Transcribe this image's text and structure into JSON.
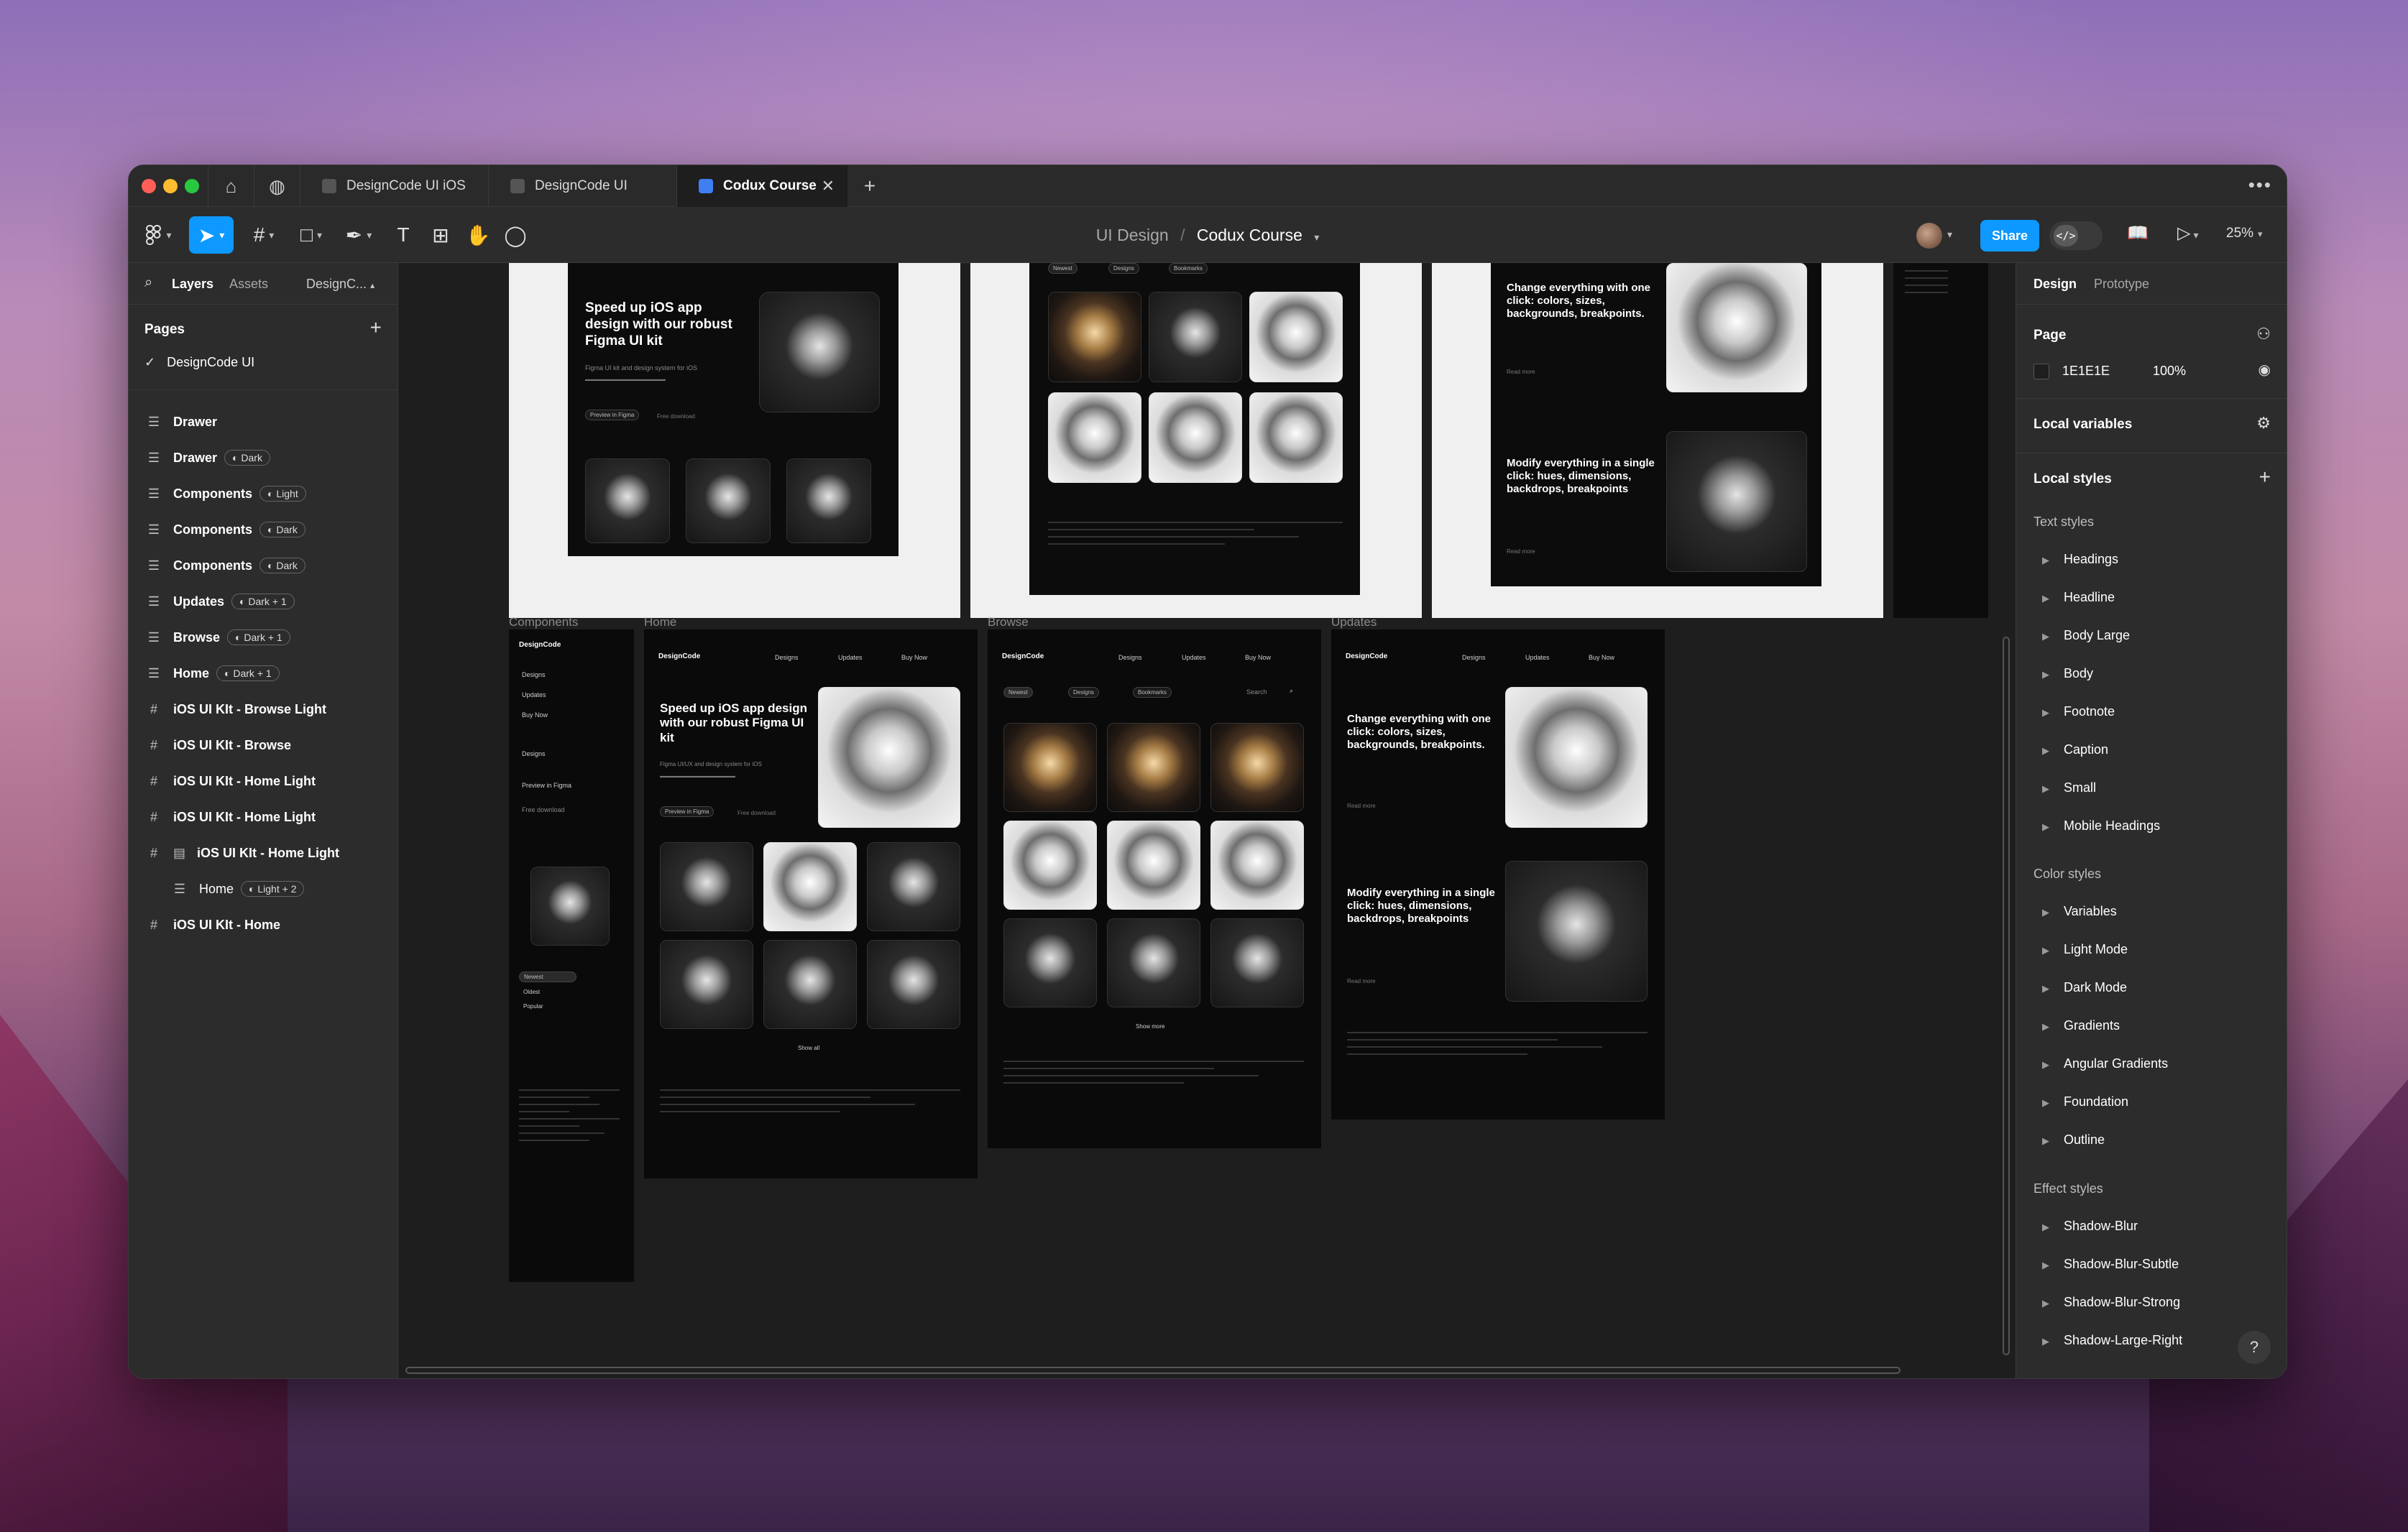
{
  "tabbar": {
    "tabs": [
      {
        "label": "DesignCode UI iOS"
      },
      {
        "label": "DesignCode UI"
      },
      {
        "label": "Codux Course"
      }
    ]
  },
  "toolbar": {
    "breadcrumb_parent": "UI Design",
    "breadcrumb_current": "Codux Course",
    "share_label": "Share",
    "zoom_label": "25%"
  },
  "left_panel": {
    "tab_layers": "Layers",
    "tab_assets": "Assets",
    "tab_file": "DesignC...",
    "pages_header": "Pages",
    "current_page": "DesignCode UI",
    "layers": [
      {
        "label": "Drawer",
        "badge": ""
      },
      {
        "label": "Drawer",
        "badge": "Dark"
      },
      {
        "label": "Components",
        "badge": "Light"
      },
      {
        "label": "Components",
        "badge": "Dark"
      },
      {
        "label": "Components",
        "badge": "Dark"
      },
      {
        "label": "Updates",
        "badge": "Dark + 1"
      },
      {
        "label": "Browse",
        "badge": "Dark + 1"
      },
      {
        "label": "Home",
        "badge": "Dark + 1"
      },
      {
        "label": "iOS UI KIt - Browse Light",
        "badge": ""
      },
      {
        "label": "iOS UI KIt - Browse",
        "badge": ""
      },
      {
        "label": "iOS UI KIt - Home Light",
        "badge": ""
      },
      {
        "label": "iOS UI KIt - Home Light",
        "badge": ""
      },
      {
        "label": "iOS UI KIt - Home Light",
        "badge": ""
      },
      {
        "label": "Home",
        "badge": "Light + 2"
      },
      {
        "label": "iOS UI KIt - Home",
        "badge": ""
      }
    ]
  },
  "canvas": {
    "frame_labels": {
      "components": "Components",
      "home": "Home",
      "browse": "Browse",
      "updates": "Updates"
    },
    "top_home_headline": "Speed up iOS app design with our robust Figma UI kit",
    "top_home_sub": "Figma UI kit and design system for iOS",
    "top_home_btn1": "Preview in Figma",
    "top_home_btn2": "Free download",
    "top_updates_headline1": "Change everything with one click: colors, sizes, backgrounds, breakpoints.",
    "top_updates_headline2": "Modify everything in a single click: hues, dimensions, backdrops, breakpoints",
    "top_updates_read": "Read more",
    "brand": "DesignCode",
    "nav": [
      "Designs",
      "Updates",
      "Buy Now"
    ],
    "home_headline": "Speed up iOS app design with our robust Figma UI kit",
    "home_sub": "Figma UI/UX and design system for iOS",
    "home_btn1": "Preview in Figma",
    "home_btn2": "Free download",
    "home_show_all": "Show all",
    "browse_filters": [
      "Newest",
      "Designs",
      "Bookmarks"
    ],
    "browse_search": "Search",
    "browse_show_more": "Show more",
    "updates_headline1": "Change everything with one click: colors, sizes, backgrounds, breakpoints.",
    "updates_headline2": "Modify everything in a single click: hues, dimensions, backdrops, breakpoints",
    "updates_read": "Read more",
    "components_items": [
      "Designs",
      "Updates",
      "Buy Now",
      "Designs"
    ],
    "components_btn": "Preview in Figma",
    "components_free": "Free download",
    "components_menu": [
      "Newest",
      "Oldest",
      "Popular"
    ]
  },
  "right_panel": {
    "tab_design": "Design",
    "tab_prototype": "Prototype",
    "page_label": "Page",
    "page_color": "1E1E1E",
    "page_opacity": "100%",
    "local_variables": "Local variables",
    "local_styles": "Local styles",
    "text_styles_title": "Text styles",
    "text_styles": [
      "Headings",
      "Headline",
      "Body Large",
      "Body",
      "Footnote",
      "Caption",
      "Small",
      "Mobile Headings"
    ],
    "color_styles_title": "Color styles",
    "color_styles": [
      "Variables",
      "Light Mode",
      "Dark Mode",
      "Gradients",
      "Angular Gradients",
      "Foundation",
      "Outline"
    ],
    "effect_styles_title": "Effect styles",
    "effect_styles": [
      "Shadow-Blur",
      "Shadow-Blur-Subtle",
      "Shadow-Blur-Strong",
      "Shadow-Large-Right"
    ],
    "help": "?"
  },
  "colors": {
    "accent": "#0d99ff",
    "canvas": "#1e1e1e",
    "panel": "#2c2c2c"
  }
}
